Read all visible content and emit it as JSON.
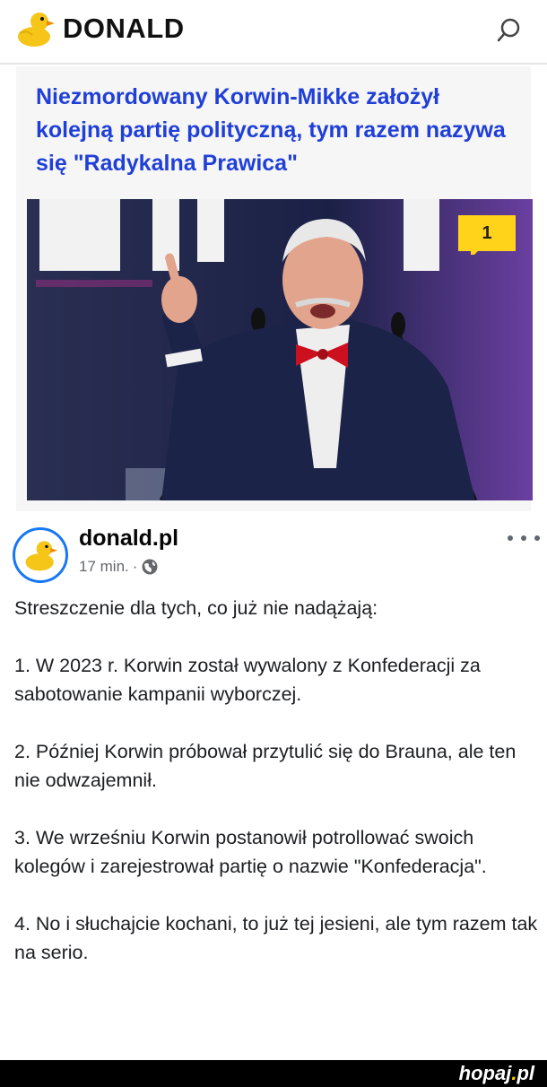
{
  "app": {
    "brand": "DONALD",
    "accent_color": "#1f3fd8",
    "brand_duck_color": "#f5c518",
    "icons": {
      "search": "search-icon",
      "logo": "duck-logo-icon",
      "comment": "comment-bubble-icon",
      "privacy": "globe-icon",
      "more": "more-options-icon"
    }
  },
  "article": {
    "headline": "Niezmordowany Korwin-Mikke założył kolejną partię polityczną, tym razem nazywa się \"Radykalna Prawica\"",
    "comment_count": "1"
  },
  "post": {
    "author": "donald.pl",
    "time": "17 min.",
    "separator": "·",
    "paragraphs": [
      "Streszczenie dla tych, co już nie nadążają:",
      "1. W 2023 r. Korwin został wywalony z Konfederacji za sabotowanie kampanii wyborczej.",
      "2. Później Korwin próbował przytulić się do Brauna, ale ten nie odwzajemnił.",
      "3. We wrześniu Korwin postanowił potrollować swoich kolegów i zarejestrował partię o nazwie \"Konfederacja\".",
      "4. No i słuchajcie kochani, to już tej jesieni, ale tym razem tak na serio."
    ]
  },
  "watermark": {
    "name": "hopaj",
    "dot": ".",
    "tld": "pl"
  }
}
